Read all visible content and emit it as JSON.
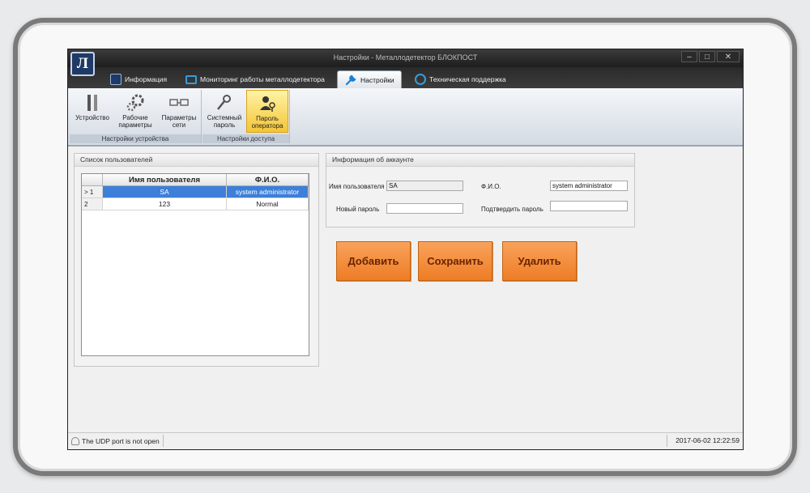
{
  "window": {
    "title": "Настройки - Металлодетектор БЛОКПОСТ"
  },
  "tabs": [
    {
      "label": "Информация"
    },
    {
      "label": "Мониторинг работы металлодетектора"
    },
    {
      "label": "Настройки"
    },
    {
      "label": "Техническая поддержка"
    }
  ],
  "active_tab": "Настройки",
  "ribbon": {
    "device_group_label": "Настройки устройства",
    "access_group_label": "Настройки доступа",
    "device_button": "Устройство",
    "work_params_line1": "Рабочие",
    "work_params_line2": "параметры",
    "net_params_line1": "Параметры",
    "net_params_line2": "сети",
    "system_pw_line1": "Системный",
    "system_pw_line2": "пароль",
    "operator_pw_line1": "Пароль",
    "operator_pw_line2": "оператора"
  },
  "users_panel": {
    "title": "Список пользователей",
    "columns": [
      "Имя пользователя",
      "Ф.И.О."
    ],
    "rows": [
      {
        "index": "1",
        "marker": ">",
        "username": "SA",
        "fio": "system administrator"
      },
      {
        "index": "2",
        "marker": "",
        "username": "123",
        "fio": "Normal"
      }
    ]
  },
  "account_panel": {
    "title": "Информация об аккаунте",
    "username_label": "Имя пользователя",
    "username_value": "SA",
    "fio_label": "Ф.И.О.",
    "fio_value": "system administrator",
    "new_password_label": "Новый пароль",
    "confirm_password_label": "Подтвердить пароль"
  },
  "actions": {
    "add": "Добавить",
    "save": "Сохранить",
    "delete": "Удалить"
  },
  "status": {
    "message": "The UDP port is not open",
    "datetime": "2017-06-02 12:22:59"
  },
  "colors": {
    "accent_orange": "#ee7d25",
    "selection_blue": "#3d7fd9",
    "active_ribbon_yellow": "#f4c534"
  }
}
